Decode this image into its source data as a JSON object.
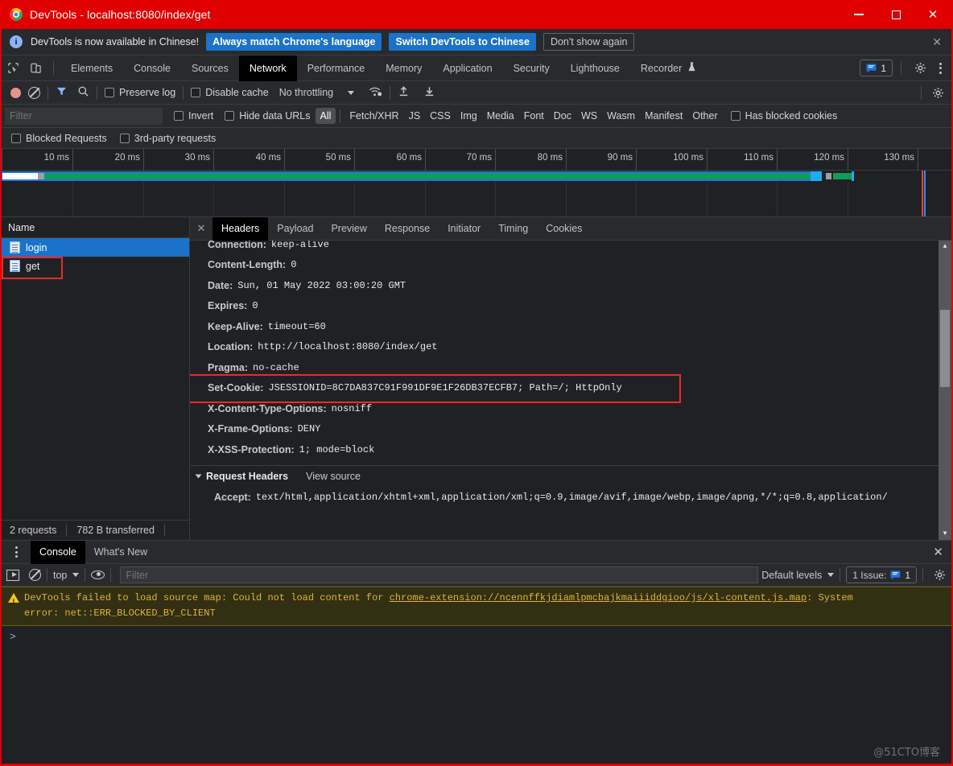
{
  "window": {
    "title": "DevTools - localhost:8080/index/get",
    "icon": "chrome-logo-icon",
    "controls": {
      "minimize": "—",
      "maximize": "□",
      "close": "✕"
    }
  },
  "infobar": {
    "icon": "info-icon",
    "message": "DevTools is now available in Chinese!",
    "buttons": [
      {
        "label": "Always match Chrome's language",
        "style": "primary"
      },
      {
        "label": "Switch DevTools to Chinese",
        "style": "primary"
      },
      {
        "label": "Don't show again",
        "style": "ghost"
      }
    ],
    "close": "✕"
  },
  "maintabs": {
    "inspect_icon": "inspect-cursor-icon",
    "device_icon": "device-toolbar-icon",
    "items": [
      {
        "label": "Elements",
        "active": false
      },
      {
        "label": "Console",
        "active": false
      },
      {
        "label": "Sources",
        "active": false
      },
      {
        "label": "Network",
        "active": true
      },
      {
        "label": "Performance",
        "active": false
      },
      {
        "label": "Memory",
        "active": false
      },
      {
        "label": "Application",
        "active": false
      },
      {
        "label": "Security",
        "active": false
      },
      {
        "label": "Lighthouse",
        "active": false
      },
      {
        "label": "Recorder",
        "active": false,
        "badge": "experiment-flask-icon"
      }
    ],
    "issues_count": "1",
    "settings_icon": "gear-icon",
    "more_icon": "kebab-menu-icon"
  },
  "network_toolbar": {
    "record_icon": "record-button-icon",
    "clear_icon": "clear-icon",
    "filter_icon": "funnel-icon",
    "search_icon": "search-icon",
    "preserve_log": "Preserve log",
    "disable_cache": "Disable cache",
    "throttling": "No throttling",
    "wifi_icon": "network-conditions-icon",
    "import_icon": "import-har-icon",
    "export_icon": "export-har-icon",
    "settings_icon": "network-settings-gear-icon"
  },
  "filterbar": {
    "placeholder": "Filter",
    "value": "",
    "invert": "Invert",
    "hide_data_urls": "Hide data URLs",
    "types": [
      {
        "label": "All",
        "selected": true
      },
      {
        "label": "Fetch/XHR",
        "selected": false
      },
      {
        "label": "JS",
        "selected": false
      },
      {
        "label": "CSS",
        "selected": false
      },
      {
        "label": "Img",
        "selected": false
      },
      {
        "label": "Media",
        "selected": false
      },
      {
        "label": "Font",
        "selected": false
      },
      {
        "label": "Doc",
        "selected": false
      },
      {
        "label": "WS",
        "selected": false
      },
      {
        "label": "Wasm",
        "selected": false
      },
      {
        "label": "Manifest",
        "selected": false
      },
      {
        "label": "Other",
        "selected": false
      }
    ],
    "has_blocked_cookies": "Has blocked cookies",
    "blocked_requests": "Blocked Requests",
    "third_party_requests": "3rd-party requests"
  },
  "overview": {
    "ticks": [
      "10 ms",
      "20 ms",
      "30 ms",
      "40 ms",
      "50 ms",
      "60 ms",
      "70 ms",
      "80 ms",
      "90 ms",
      "100 ms",
      "110 ms",
      "120 ms",
      "130 ms"
    ]
  },
  "requests": {
    "column_header": "Name",
    "rows": [
      {
        "name": "login",
        "icon": "document-icon",
        "selected": true,
        "annotated": true
      },
      {
        "name": "get",
        "icon": "document-icon",
        "selected": false,
        "annotated": false
      }
    ],
    "status": {
      "requests": "2 requests",
      "transferred": "782 B transferred"
    }
  },
  "detail": {
    "close": "✕",
    "tabs": [
      {
        "label": "Headers",
        "active": true
      },
      {
        "label": "Payload",
        "active": false
      },
      {
        "label": "Preview",
        "active": false
      },
      {
        "label": "Response",
        "active": false
      },
      {
        "label": "Initiator",
        "active": false
      },
      {
        "label": "Timing",
        "active": false
      },
      {
        "label": "Cookies",
        "active": false
      }
    ],
    "response_headers": [
      {
        "name": "Connection:",
        "value": "keep-alive",
        "clipped": true
      },
      {
        "name": "Content-Length:",
        "value": "0"
      },
      {
        "name": "Date:",
        "value": "Sun, 01 May 2022 03:00:20 GMT"
      },
      {
        "name": "Expires:",
        "value": "0"
      },
      {
        "name": "Keep-Alive:",
        "value": "timeout=60"
      },
      {
        "name": "Location:",
        "value": "http://localhost:8080/index/get"
      },
      {
        "name": "Pragma:",
        "value": "no-cache"
      },
      {
        "name": "Set-Cookie:",
        "value": "JSESSIONID=8C7DA837C91F991DF9E1F26DB37ECFB7; Path=/; HttpOnly",
        "highlighted": true
      },
      {
        "name": "X-Content-Type-Options:",
        "value": "nosniff"
      },
      {
        "name": "X-Frame-Options:",
        "value": "DENY"
      },
      {
        "name": "X-XSS-Protection:",
        "value": "1; mode=block"
      }
    ],
    "request_headers_section": {
      "title": "Request Headers",
      "view_source": "View source",
      "first_header_name": "Accept:",
      "first_header_value": "text/html,application/xhtml+xml,application/xml;q=0.9,image/avif,image/webp,image/apng,*/*;q=0.8,application/"
    }
  },
  "drawer": {
    "more_icon": "kebab-menu-icon",
    "tabs": [
      {
        "label": "Console",
        "active": true
      },
      {
        "label": "What's New",
        "active": false
      }
    ],
    "close": "✕",
    "toolbar": {
      "execute_icon": "execution-context-icon",
      "clear_icon": "clear-console-icon",
      "context": "top",
      "eye_icon": "live-expression-eye-icon",
      "filter_placeholder": "Filter",
      "filter_value": "",
      "levels": "Default levels",
      "issues_label": "1 Issue:",
      "issues_count": "1",
      "settings_icon": "gear-icon"
    },
    "message": {
      "icon": "warning-icon",
      "text_before": "DevTools failed to load source map: Could not load content for ",
      "link": "chrome-extension://ncennffkjdiamlpmcbajkmaiiiddgioo/js/xl-content.js.map",
      "text_after": ": System",
      "line2": "error: net::ERR_BLOCKED_BY_CLIENT"
    },
    "prompt": ">"
  },
  "watermark": "@51CTO博客",
  "colors": {
    "title_bar": "#e00000",
    "accent_blue": "#1a73c8",
    "selection": "#1a73c8",
    "annotation_red": "#ef2929",
    "warning_bg": "#322f13",
    "warning_text": "#e2b33a"
  }
}
